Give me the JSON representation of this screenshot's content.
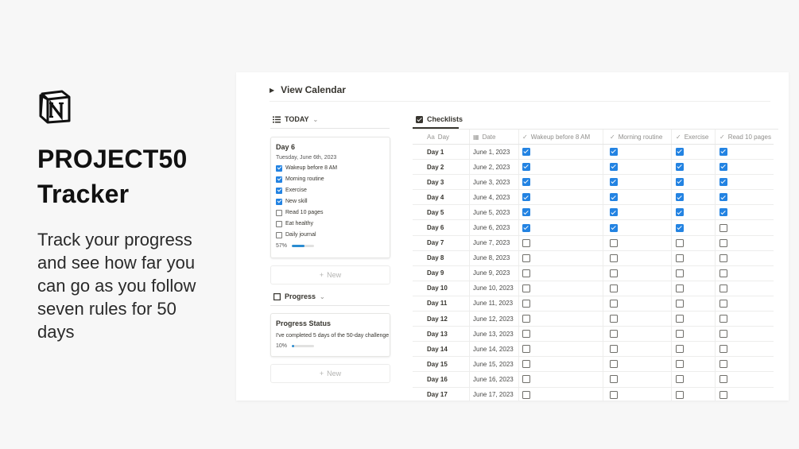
{
  "hero": {
    "title_line1": "PROJECT50",
    "title_line2": "Tracker",
    "subtitle": "Track your progress and see how far you can go as you follow seven rules for 50 days"
  },
  "panel": {
    "view_calendar": "View Calendar",
    "today_tab": "TODAY",
    "progress_tab": "Progress",
    "new_label": "New",
    "day_card": {
      "title": "Day 6",
      "date": "Tuesday, June 6th, 2023",
      "tasks": [
        {
          "label": "Wakeup before 8 AM",
          "checked": true
        },
        {
          "label": "Morning routine",
          "checked": true
        },
        {
          "label": "Exercise",
          "checked": true
        },
        {
          "label": "New skill",
          "checked": true
        },
        {
          "label": "Read 10 pages",
          "checked": false
        },
        {
          "label": "Eat healthy",
          "checked": false
        },
        {
          "label": "Daily journal",
          "checked": false
        }
      ],
      "progress_label": "57%",
      "progress_value": 0.57
    },
    "progress_card": {
      "title": "Progress Status",
      "description": "I've completed 5 days of the 50-day challenge",
      "progress_label": "10%",
      "progress_value": 0.1
    },
    "checklists_tab": "Checklists",
    "columns": [
      "Day",
      "Date",
      "Wakeup before 8 AM",
      "Morning routine",
      "Exercise",
      "Read 10 pages"
    ],
    "column_icons": [
      "Aa",
      "calendar-icon",
      "check-icon",
      "check-icon",
      "check-icon",
      "check-icon"
    ],
    "rows": [
      {
        "day": "Day 1",
        "date": "June 1, 2023",
        "checks": [
          true,
          true,
          true,
          true
        ]
      },
      {
        "day": "Day 2",
        "date": "June 2, 2023",
        "checks": [
          true,
          true,
          true,
          true
        ]
      },
      {
        "day": "Day 3",
        "date": "June 3, 2023",
        "checks": [
          true,
          true,
          true,
          true
        ]
      },
      {
        "day": "Day 4",
        "date": "June 4, 2023",
        "checks": [
          true,
          true,
          true,
          true
        ]
      },
      {
        "day": "Day 5",
        "date": "June 5, 2023",
        "checks": [
          true,
          true,
          true,
          true
        ]
      },
      {
        "day": "Day 6",
        "date": "June 6, 2023",
        "checks": [
          true,
          true,
          true,
          false
        ]
      },
      {
        "day": "Day 7",
        "date": "June 7, 2023",
        "checks": [
          false,
          false,
          false,
          false
        ]
      },
      {
        "day": "Day 8",
        "date": "June 8, 2023",
        "checks": [
          false,
          false,
          false,
          false
        ]
      },
      {
        "day": "Day 9",
        "date": "June 9, 2023",
        "checks": [
          false,
          false,
          false,
          false
        ]
      },
      {
        "day": "Day 10",
        "date": "June 10, 2023",
        "checks": [
          false,
          false,
          false,
          false
        ]
      },
      {
        "day": "Day 11",
        "date": "June 11, 2023",
        "checks": [
          false,
          false,
          false,
          false
        ]
      },
      {
        "day": "Day 12",
        "date": "June 12, 2023",
        "checks": [
          false,
          false,
          false,
          false
        ]
      },
      {
        "day": "Day 13",
        "date": "June 13, 2023",
        "checks": [
          false,
          false,
          false,
          false
        ]
      },
      {
        "day": "Day 14",
        "date": "June 14, 2023",
        "checks": [
          false,
          false,
          false,
          false
        ]
      },
      {
        "day": "Day 15",
        "date": "June 15, 2023",
        "checks": [
          false,
          false,
          false,
          false
        ]
      },
      {
        "day": "Day 16",
        "date": "June 16, 2023",
        "checks": [
          false,
          false,
          false,
          false
        ]
      },
      {
        "day": "Day 17",
        "date": "June 17, 2023",
        "checks": [
          false,
          false,
          false,
          false
        ]
      }
    ]
  },
  "colors": {
    "accent": "#2383e2",
    "progress": "#2a8cd1",
    "background": "#f7f7f7"
  }
}
